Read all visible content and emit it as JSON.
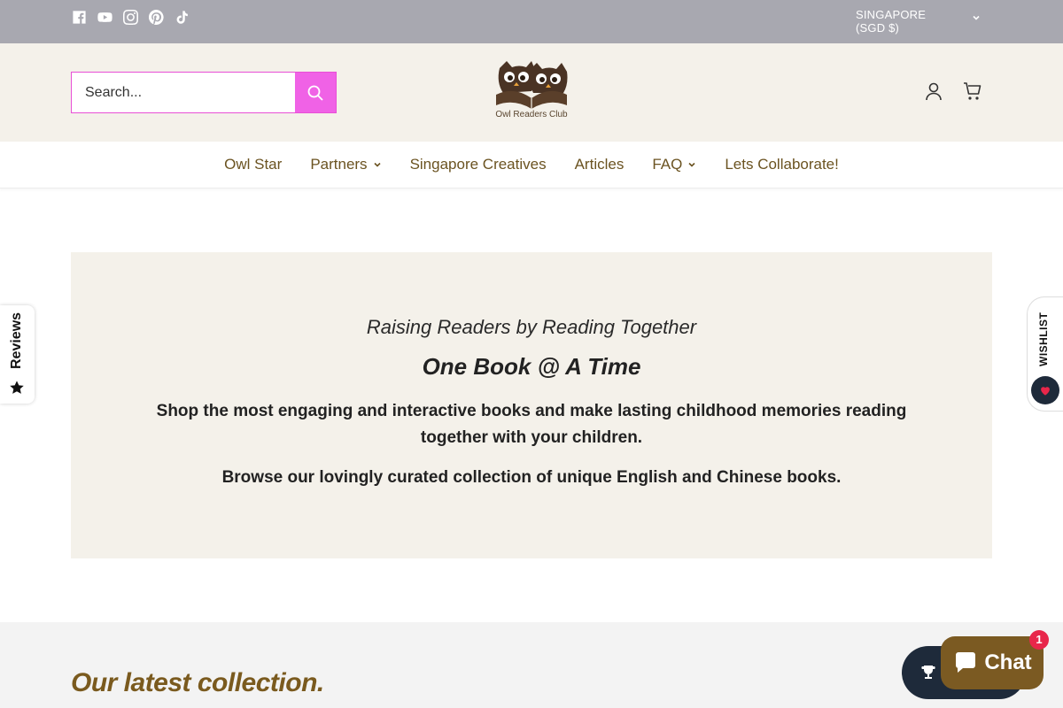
{
  "topbar": {
    "social_icons": [
      "facebook-icon",
      "youtube-icon",
      "instagram-icon",
      "pinterest-icon",
      "tiktok-icon"
    ],
    "currency_line1": "SINGAPORE",
    "currency_line2": "(SGD $)"
  },
  "header": {
    "search_placeholder": "Search...",
    "logo_text": "Owl Readers Club"
  },
  "nav": {
    "items": [
      {
        "label": "Owl Star",
        "has_dropdown": false
      },
      {
        "label": "Partners",
        "has_dropdown": true
      },
      {
        "label": "Singapore Creatives",
        "has_dropdown": false
      },
      {
        "label": "Articles",
        "has_dropdown": false
      },
      {
        "label": "FAQ",
        "has_dropdown": true
      },
      {
        "label": "Lets Collaborate!",
        "has_dropdown": false
      }
    ]
  },
  "hero": {
    "tagline": "Raising Readers by Reading Together",
    "title": "One Book @ A Time",
    "paragraph1": "Shop the most engaging and interactive books and make lasting childhood memories reading together with your children.",
    "paragraph2": "Browse our lovingly curated collection of unique English and Chinese books."
  },
  "latest": {
    "heading": "Our latest collection."
  },
  "widgets": {
    "reviews_label": "Reviews",
    "wishlist_label": "WISHLIST",
    "chat_label": "Chat",
    "chat_badge": "1"
  },
  "colors": {
    "topbar": "#a8a8b0",
    "header_bg": "#f4f1ea",
    "accent_pink": "#f062e6",
    "brand_brown": "#7b5a22",
    "nav_text": "#6b5321"
  }
}
